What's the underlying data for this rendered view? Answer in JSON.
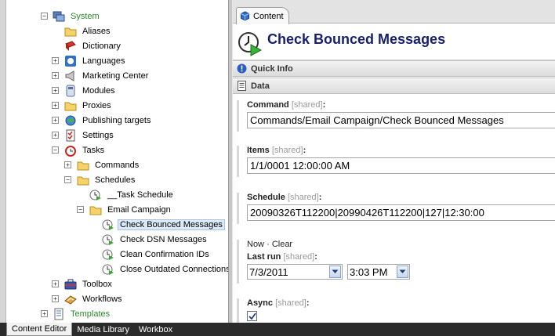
{
  "tree": {
    "items": [
      {
        "label": "System",
        "expander": "−"
      },
      {
        "label": "Aliases",
        "expander": ""
      },
      {
        "label": "Dictionary",
        "expander": ""
      },
      {
        "label": "Languages",
        "expander": "+"
      },
      {
        "label": "Marketing Center",
        "expander": "+"
      },
      {
        "label": "Modules",
        "expander": "+"
      },
      {
        "label": "Proxies",
        "expander": "+"
      },
      {
        "label": "Publishing targets",
        "expander": "+"
      },
      {
        "label": "Settings",
        "expander": "+"
      },
      {
        "label": "Tasks",
        "expander": "−"
      },
      {
        "label": "Commands",
        "expander": "+"
      },
      {
        "label": "Schedules",
        "expander": "−"
      },
      {
        "label": "__Task Schedule",
        "expander": ""
      },
      {
        "label": "Email Campaign",
        "expander": "−"
      },
      {
        "label": "Check Bounced Messages",
        "expander": ""
      },
      {
        "label": "Check DSN Messages",
        "expander": ""
      },
      {
        "label": "Clean Confirmation IDs",
        "expander": ""
      },
      {
        "label": "Close Outdated Connections",
        "expander": ""
      },
      {
        "label": "Toolbox",
        "expander": "+"
      },
      {
        "label": "Workflows",
        "expander": "+"
      },
      {
        "label": "Templates",
        "expander": "+"
      }
    ]
  },
  "content": {
    "tab_label": "Content",
    "title": "Check Bounced Messages",
    "sections": {
      "quick_info": "Quick Info",
      "data": "Data"
    },
    "shared_tag": "[shared]",
    "colon": ":",
    "fields": {
      "command": {
        "label": "Command",
        "value": "Commands/Email Campaign/Check Bounced Messages"
      },
      "items": {
        "label": "Items",
        "value": "1/1/0001 12:00:00 AM"
      },
      "schedule": {
        "label": "Schedule",
        "value": "20090326T112200|20990426T112200|127|12:30:00"
      },
      "last_run": {
        "label": "Last run",
        "link_now": "Now",
        "separator": "·",
        "link_clear": "Clear",
        "date": "7/3/2011",
        "time": "3:03 PM"
      },
      "async": {
        "label": "Async",
        "checked": true
      }
    }
  },
  "bottom_tabs": [
    "Content Editor",
    "Media Library",
    "Workbox"
  ],
  "colors": {
    "accent_title": "#17206b",
    "selected_bg": "#dce9f7",
    "green_label": "#2c8a2c"
  }
}
